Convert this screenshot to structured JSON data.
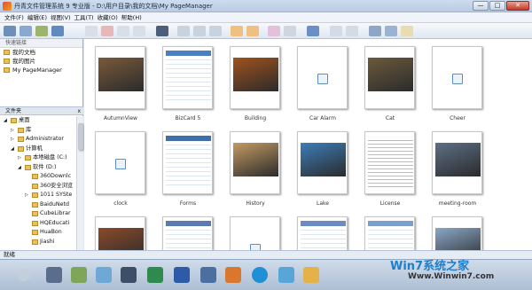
{
  "window": {
    "title": "丹青文件管理系统 9 专业版 - D:\\用户目录\\我的文档\\My PageManager",
    "min": "—",
    "max": "□",
    "close": "✕"
  },
  "menu": [
    "文件(F)",
    "编辑(E)",
    "视图(V)",
    "工具(T)",
    "收藏(O)",
    "帮助(H)"
  ],
  "quick": {
    "header": "快速链接",
    "items": [
      "我的文档",
      "我的图片",
      "My PageManager"
    ]
  },
  "folders": {
    "header": "文件夹",
    "close": "x",
    "tree": [
      {
        "indent": 0,
        "label": "桌面",
        "exp": "◢"
      },
      {
        "indent": 1,
        "label": "库",
        "exp": "▷"
      },
      {
        "indent": 1,
        "label": "Administrator",
        "exp": "▷"
      },
      {
        "indent": 1,
        "label": "计算机",
        "exp": "◢"
      },
      {
        "indent": 2,
        "label": "本地磁盘 (C:)",
        "exp": "▷"
      },
      {
        "indent": 2,
        "label": "软件 (D:)",
        "exp": "◢"
      },
      {
        "indent": 3,
        "label": "360Downlc",
        "exp": ""
      },
      {
        "indent": 3,
        "label": "360安全浏览",
        "exp": ""
      },
      {
        "indent": 3,
        "label": "1011 SYSte",
        "exp": "▷"
      },
      {
        "indent": 3,
        "label": "BaiduNetd",
        "exp": ""
      },
      {
        "indent": 3,
        "label": "CubeLibrar",
        "exp": ""
      },
      {
        "indent": 3,
        "label": "HQEducati",
        "exp": ""
      },
      {
        "indent": 3,
        "label": "HuaBon",
        "exp": ""
      },
      {
        "indent": 3,
        "label": "Jiashi",
        "exp": ""
      }
    ]
  },
  "thumbnails": [
    {
      "label": "AutumnView",
      "kind": "photo",
      "color": "#7a5a3a"
    },
    {
      "label": "BizCard 5",
      "kind": "doc",
      "color": "#4a7fc1"
    },
    {
      "label": "Building",
      "kind": "photo",
      "color": "#a0521d"
    },
    {
      "label": "Car Alarm",
      "kind": "blank",
      "color": "#ffffff"
    },
    {
      "label": "Cat",
      "kind": "photo",
      "color": "#6b5a3c"
    },
    {
      "label": "Cheer",
      "kind": "blank",
      "color": "#ffffff"
    },
    {
      "label": "clock",
      "kind": "blank",
      "color": "#ffffff"
    },
    {
      "label": "Forms",
      "kind": "doc",
      "color": "#3e6fa8"
    },
    {
      "label": "History",
      "kind": "photo",
      "color": "#c49a63"
    },
    {
      "label": "Lake",
      "kind": "photo",
      "color": "#3c7db8"
    },
    {
      "label": "License",
      "kind": "text",
      "color": "#888888"
    },
    {
      "label": "meeting-room",
      "kind": "photo",
      "color": "#5d6f86"
    },
    {
      "label": "",
      "kind": "photo",
      "color": "#8a4a2a"
    },
    {
      "label": "",
      "kind": "doc",
      "color": "#5a7bb0"
    },
    {
      "label": "",
      "kind": "blank",
      "color": "#ffffff"
    },
    {
      "label": "",
      "kind": "doc",
      "color": "#6b8cc0"
    },
    {
      "label": "",
      "kind": "doc",
      "color": "#7a9fc9"
    },
    {
      "label": "",
      "kind": "photo",
      "color": "#8aa8c8"
    }
  ],
  "status": "就绪",
  "watermark": {
    "brand": "Win7系统之家",
    "url": "Www.Winwin7.com"
  }
}
